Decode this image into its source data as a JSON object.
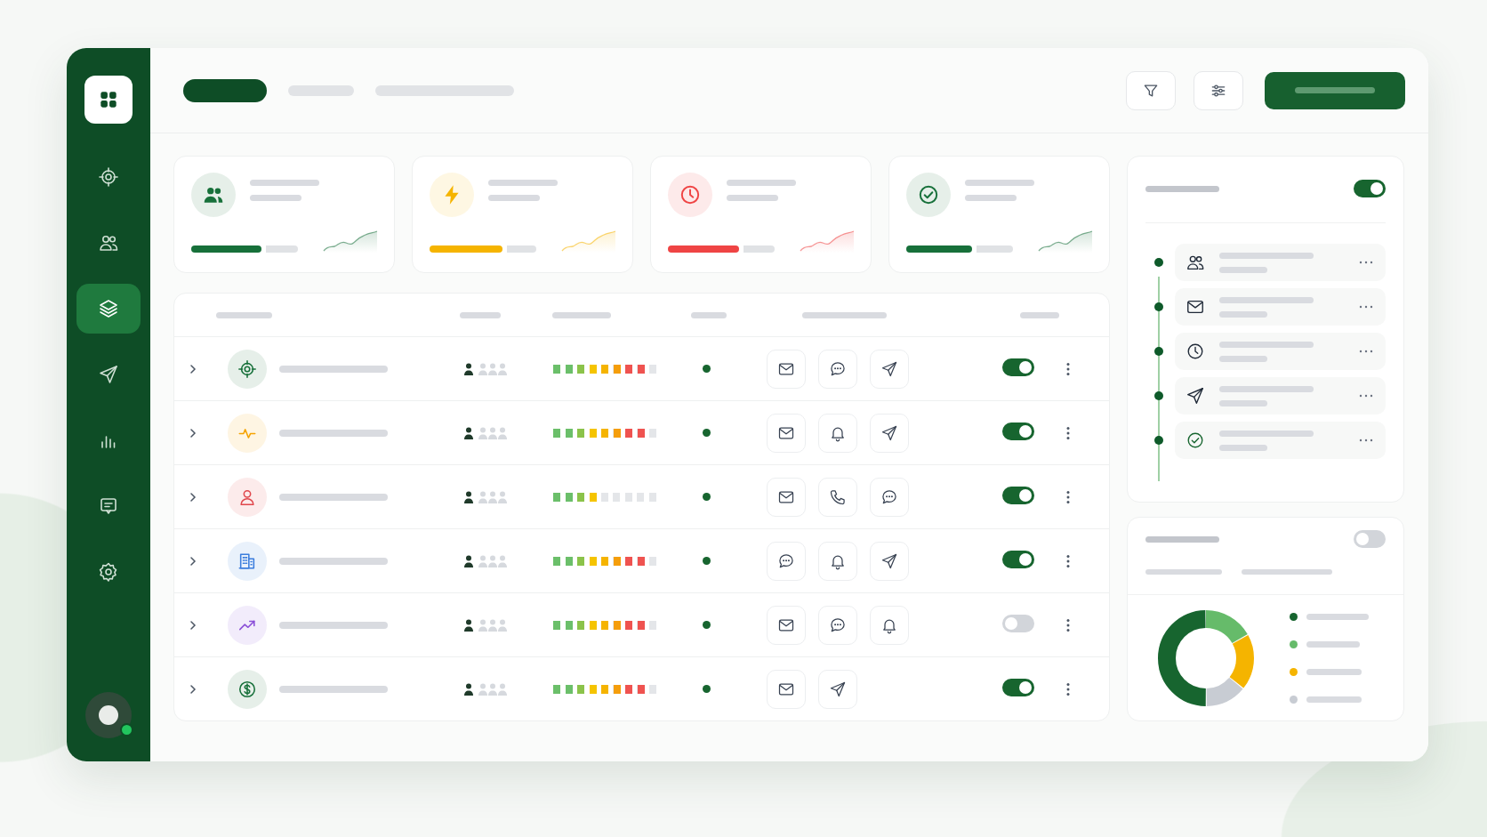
{
  "sidebar": {
    "items": [
      {
        "kind": "target",
        "selected": false
      },
      {
        "kind": "users",
        "selected": false
      },
      {
        "kind": "layers",
        "selected": true
      },
      {
        "kind": "send",
        "selected": false
      },
      {
        "kind": "chart",
        "selected": false
      },
      {
        "kind": "message",
        "selected": false
      },
      {
        "kind": "settings",
        "selected": false
      }
    ]
  },
  "tabs": [
    {
      "selected": true
    },
    {
      "selected": false
    },
    {
      "selected": false
    }
  ],
  "stat_cards": [
    {
      "kind": "users",
      "color": "#17703a",
      "level": 0.66
    },
    {
      "kind": "bolt",
      "color": "#f5b400",
      "level": 0.68
    },
    {
      "kind": "clock",
      "color": "#ef4444",
      "level": 0.67
    },
    {
      "kind": "check",
      "color": "#17703a",
      "level": 0.62
    }
  ],
  "table": {
    "rows": [
      {
        "kind": "target",
        "color": "#17703a",
        "level": 0.89,
        "actions": [
          {
            "kind": "mail"
          },
          {
            "kind": "chat"
          },
          {
            "kind": "send"
          }
        ],
        "on": true
      },
      {
        "kind": "pulse",
        "color": "#f5a300",
        "level": 0.89,
        "actions": [
          {
            "kind": "mail"
          },
          {
            "kind": "bell"
          },
          {
            "kind": "send"
          }
        ],
        "on": true
      },
      {
        "kind": "person",
        "color": "#e0474c",
        "level": 0.44,
        "actions": [
          {
            "kind": "mail"
          },
          {
            "kind": "phone"
          },
          {
            "kind": "chat"
          }
        ],
        "on": true
      },
      {
        "kind": "building",
        "color": "#3b7ddd",
        "level": 0.89,
        "actions": [
          {
            "kind": "chat"
          },
          {
            "kind": "bell"
          },
          {
            "kind": "send"
          }
        ],
        "on": true
      },
      {
        "kind": "trend",
        "color": "#8b4fd8",
        "level": 0.89,
        "actions": [
          {
            "kind": "mail"
          },
          {
            "kind": "chat"
          },
          {
            "kind": "bell"
          }
        ],
        "on": false
      },
      {
        "kind": "dollar",
        "color": "#17703a",
        "level": 0.89,
        "actions": [
          {
            "kind": "mail"
          },
          {
            "kind": "send"
          }
        ],
        "on": true
      }
    ]
  },
  "activity_panel": {
    "on": true,
    "items": [
      {
        "kind": "users"
      },
      {
        "kind": "mail"
      },
      {
        "kind": "clock"
      },
      {
        "kind": "send"
      },
      {
        "kind": "check"
      }
    ]
  },
  "breakdown_panel": {
    "on": false,
    "legend": [
      {
        "color": "#17652f"
      },
      {
        "color": "#66bb6a"
      },
      {
        "color": "#f5b400"
      },
      {
        "color": "#c8ccd3"
      }
    ]
  }
}
